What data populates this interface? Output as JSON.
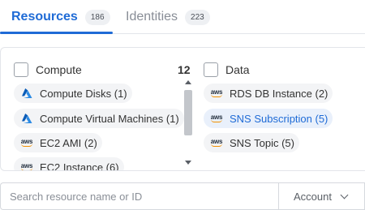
{
  "tabs": [
    {
      "label": "Resources",
      "count": "186",
      "active": true
    },
    {
      "label": "Identities",
      "count": "223",
      "active": false
    }
  ],
  "columns": {
    "compute": {
      "title": "Compute",
      "count": "12",
      "items": [
        {
          "label": "Compute Disks (1)",
          "icon": "azure-icon"
        },
        {
          "label": "Compute Virtual Machines (1)",
          "icon": "azure-icon"
        },
        {
          "label": "EC2 AMI (2)",
          "icon": "aws-icon"
        },
        {
          "label": "EC2 Instance (6)",
          "icon": "aws-icon"
        }
      ]
    },
    "data": {
      "title": "Data",
      "items": [
        {
          "label": "RDS DB Instance (2)",
          "icon": "aws-icon",
          "active": false
        },
        {
          "label": "SNS Subscription (5)",
          "icon": "aws-icon",
          "active": true
        },
        {
          "label": "SNS Topic (5)",
          "icon": "aws-icon",
          "active": false
        }
      ]
    }
  },
  "aws_icon_text": "aws",
  "search": {
    "placeholder": "Search resource name or ID",
    "value": ""
  },
  "account_filter": {
    "label": "Account"
  },
  "colors": {
    "accent": "#1f6bd6",
    "chip_bg": "#f3f4f6",
    "chip_active_bg": "#e9f0fb",
    "aws_orange": "#f29100",
    "azure_blue": "#0078d4"
  }
}
